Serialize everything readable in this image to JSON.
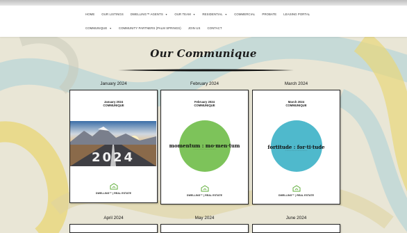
{
  "nav": {
    "row1": [
      {
        "label": "HOME",
        "dropdown": false
      },
      {
        "label": "OUR LISTINGS",
        "dropdown": false
      },
      {
        "label": "DWELLING™ AGENTS",
        "dropdown": true
      },
      {
        "label": "OUR TEAM",
        "dropdown": true
      },
      {
        "label": "RESIDENTIAL",
        "dropdown": true
      },
      {
        "label": "COMMERCIAL",
        "dropdown": false
      },
      {
        "label": "PROBATE",
        "dropdown": false
      },
      {
        "label": "LEASING PORTAL",
        "dropdown": false
      }
    ],
    "row2": [
      {
        "label": "COMMUNIQUE",
        "dropdown": true
      },
      {
        "label": "COMMUNITY PARTNERS (PALM SPRINGS)",
        "dropdown": false
      },
      {
        "label": "JOIN US",
        "dropdown": false
      },
      {
        "label": "CONTACT",
        "dropdown": false
      }
    ]
  },
  "page": {
    "heading": "Our Communique"
  },
  "months": [
    {
      "label": "January 2024",
      "card_title_line1": "January 2024",
      "card_title_line2": "COMMUNIQUE",
      "photo_text": "2024",
      "brand": "DWELLING™ | REAL ESTATE"
    },
    {
      "label": "February 2024",
      "card_title_line1": "February 2024",
      "card_title_line2": "COMMUNIQUE",
      "circle_word": "momentum : mo·men·tum",
      "circle_color": "#7dc35a",
      "brand": "DWELLING™ | REAL ESTATE"
    },
    {
      "label": "March 2024",
      "card_title_line1": "March 2024",
      "card_title_line2": "COMMUNIQUE",
      "circle_word": "fortitude : for·ti·tude",
      "circle_color": "#4fb9cc",
      "brand": "DWELLING™ | REAL ESTATE"
    },
    {
      "label": "April 2024"
    },
    {
      "label": "May 2024"
    },
    {
      "label": "June 2024"
    }
  ],
  "colors": {
    "logo_green": "#5fae3a",
    "background": "#e9e6d6",
    "swirl_yellow": "#e8d77a",
    "swirl_blue": "#a9cfd8"
  },
  "icons": {
    "caret": "chevron-down-icon",
    "logo": "dwelling-logo-icon"
  }
}
